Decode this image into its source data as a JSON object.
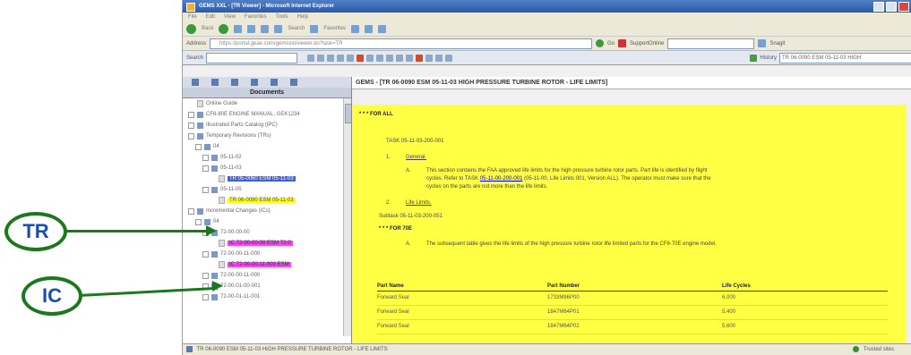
{
  "window": {
    "title": "GEMS XXL - [TR Viewer] - Microsoft Internet Explorer",
    "menu": [
      "File",
      "Edit",
      "View",
      "Favorites",
      "Tools",
      "Help"
    ],
    "toolbar": {
      "back": "Back",
      "search": "Search",
      "favorites": "Favorites"
    },
    "address_label": "Address",
    "address_value": "https://portal.geae.com/gemsxxl/viewer.do?task=TR",
    "go_label": "Go",
    "support_label": "SupportOnline",
    "snagit_label": "Snagit"
  },
  "app_toolbar": {
    "search_label": "Search",
    "history_label": "History",
    "history_value": "TR 06-0090 ESM 05-11-03 HIGH"
  },
  "left_panel": {
    "header": "Documents",
    "tree": [
      {
        "indent": 0,
        "icon": "page",
        "label": "Online Guide",
        "hl": ""
      },
      {
        "indent": 0,
        "icon": "book",
        "label": "CF6-80E ENGINE MANUAL, GEK1234",
        "hl": ""
      },
      {
        "indent": 0,
        "icon": "book",
        "label": "Illustrated Parts Catalog (IPC)",
        "hl": ""
      },
      {
        "indent": 0,
        "icon": "book",
        "label": "Temporary Revisions (TRs)",
        "hl": ""
      },
      {
        "indent": 1,
        "icon": "book",
        "label": "04",
        "hl": ""
      },
      {
        "indent": 2,
        "icon": "book",
        "label": "05-11-02",
        "hl": ""
      },
      {
        "indent": 2,
        "icon": "book",
        "label": "05-11-03",
        "hl": ""
      },
      {
        "indent": 3,
        "icon": "page",
        "label": "TR 05-0060 ESM 05-11-03",
        "hl": "blue"
      },
      {
        "indent": 2,
        "icon": "book",
        "label": "05-11-05",
        "hl": ""
      },
      {
        "indent": 3,
        "icon": "page",
        "label": "TR 06-0090 ESM 05-11-03",
        "hl": "yellow"
      },
      {
        "indent": 0,
        "icon": "book",
        "label": "Incremental Changes (ICs)",
        "hl": ""
      },
      {
        "indent": 1,
        "icon": "book",
        "label": "04",
        "hl": ""
      },
      {
        "indent": 2,
        "icon": "book",
        "label": "72-00-00-00",
        "hl": ""
      },
      {
        "indent": 3,
        "icon": "page",
        "label": "IC 72-00-00-00 ESM 72-0",
        "hl": "magenta"
      },
      {
        "indent": 2,
        "icon": "book",
        "label": "72-00-00-11-000",
        "hl": ""
      },
      {
        "indent": 3,
        "icon": "page",
        "label": "IC 72-00-00-11-000 ESM",
        "hl": "magenta"
      },
      {
        "indent": 2,
        "icon": "book",
        "label": "72-00-00-11-000",
        "hl": ""
      },
      {
        "indent": 2,
        "icon": "book",
        "label": "72-00-01-00-001",
        "hl": ""
      },
      {
        "indent": 2,
        "icon": "book",
        "label": "72-00-01-11-001",
        "hl": ""
      }
    ]
  },
  "content": {
    "title": "GEMS - [TR 06-0090 ESM 05-11-03 HIGH PRESSURE TURBINE ROTOR - LIFE LIMITS]",
    "for_all": "* * * FOR ALL",
    "task": "TASK 05-11-03-200-001",
    "sec1_num": "1.",
    "sec1_title": "General.",
    "sec1a_label": "A.",
    "sec1a_line1": "This section contains the FAA approved life limits for the high pressure turbine rotor parts. Part life is identified by flight",
    "sec1a_line2_pre": "cycles. Refer to TASK",
    "sec1a_link": "05-11-00-200-001",
    "sec1a_line2_post": "(05-11-00, Life Limits 001, Version ALL). The operator must make sure that the",
    "sec1a_line3": "cycles on the parts are not more than the life limits.",
    "sec2_num": "2.",
    "sec2_title": "Life Limits.",
    "subtask": "Subtask 05-11-03-200-051",
    "for_model": "* * * FOR 70E",
    "sec2a_label": "A.",
    "sec2a_text": "The subsequent table gives the life limits of the high pressure turbine rotor life limited parts for the CF6-70E engine model.",
    "table": {
      "headers": [
        "Part Name",
        "Part Number",
        "Life Cycles"
      ],
      "rows": [
        [
          "Forward Seal",
          "1733M86P00",
          "6,000"
        ],
        [
          "Forward Seal",
          "1847M64P01",
          "5,400"
        ],
        [
          "Forward Seal",
          "1847M64P02",
          "5,600"
        ]
      ]
    }
  },
  "statusbar": {
    "text": "TR 06-0090 ESM 05-11-03 HIGH PRESSURE TURBINE ROTOR - LIFE LIMITS",
    "zone": "Trusted sites"
  },
  "callouts": {
    "tr": "TR",
    "ic": "IC"
  },
  "colors": {
    "content_bg": "#ffff44",
    "hl_blue": "#4060e0",
    "hl_yellow": "#ffff00",
    "hl_magenta": "#ff40ff",
    "callout_border": "#1a7a1a",
    "callout_text": "#1a4fa8"
  }
}
